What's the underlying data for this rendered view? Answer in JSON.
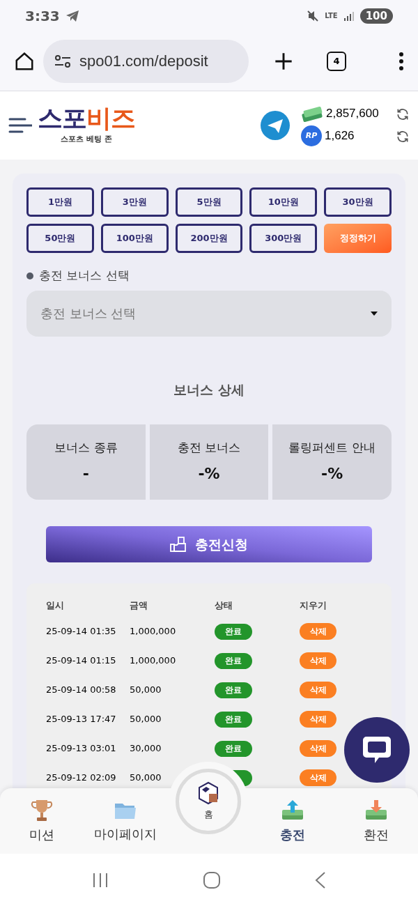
{
  "status_bar": {
    "time": "3:33",
    "network": "LTE",
    "battery": "100"
  },
  "browser": {
    "url": "spo01.com/deposit",
    "tab_count": "4"
  },
  "header": {
    "logo_part1": "스포",
    "logo_part2": "비즈",
    "logo_sub": "스포츠 베팅 존",
    "money": "2,857,600",
    "points": "1,626",
    "points_badge": "RP"
  },
  "amount_buttons": [
    {
      "label": "1만원",
      "kind": "amount"
    },
    {
      "label": "3만원",
      "kind": "amount"
    },
    {
      "label": "5만원",
      "kind": "amount"
    },
    {
      "label": "10만원",
      "kind": "amount"
    },
    {
      "label": "30만원",
      "kind": "amount"
    },
    {
      "label": "50만원",
      "kind": "amount"
    },
    {
      "label": "100만원",
      "kind": "amount"
    },
    {
      "label": "200만원",
      "kind": "amount"
    },
    {
      "label": "300만원",
      "kind": "amount"
    },
    {
      "label": "정정하기",
      "kind": "reset"
    }
  ],
  "bonus_select": {
    "label": "충전 보너스 선택",
    "placeholder": "충전 보너스 선택"
  },
  "bonus_detail": {
    "title": "보너스 상세",
    "items": [
      {
        "label": "보너스 종류",
        "value": "-"
      },
      {
        "label": "충전 보너스",
        "value": "-%"
      },
      {
        "label": "롤링퍼센트 안내",
        "value": "-%"
      }
    ]
  },
  "apply_button": "충전신청",
  "table": {
    "columns": [
      "일시",
      "금액",
      "상태",
      "지우기"
    ],
    "rows": [
      {
        "date": "25-09-14 01:35",
        "amount": "1,000,000",
        "status": "완료",
        "action": "삭제"
      },
      {
        "date": "25-09-14 01:15",
        "amount": "1,000,000",
        "status": "완료",
        "action": "삭제"
      },
      {
        "date": "25-09-14 00:58",
        "amount": "50,000",
        "status": "완료",
        "action": "삭제"
      },
      {
        "date": "25-09-13 17:47",
        "amount": "50,000",
        "status": "완료",
        "action": "삭제"
      },
      {
        "date": "25-09-13 03:01",
        "amount": "30,000",
        "status": "완료",
        "action": "삭제"
      },
      {
        "date": "25-09-12 02:09",
        "amount": "50,000",
        "action": "삭제"
      }
    ]
  },
  "bottom_nav": [
    {
      "label": "미션",
      "kind": "trophy",
      "selected": false
    },
    {
      "label": "마이페이지",
      "kind": "folder",
      "selected": false
    },
    {
      "label": "홈",
      "kind": "home",
      "selected": false
    },
    {
      "label": "충전",
      "kind": "deposit",
      "selected": true
    },
    {
      "label": "환전",
      "kind": "withdraw",
      "selected": false
    }
  ]
}
